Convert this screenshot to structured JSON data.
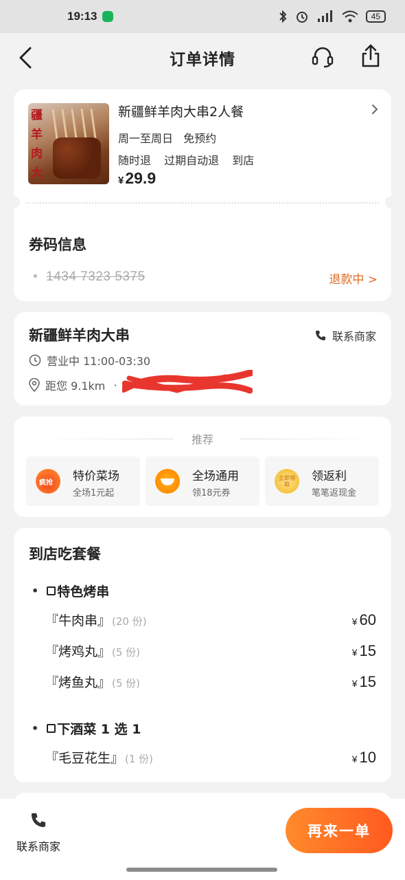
{
  "status_bar": {
    "time": "19:13",
    "battery": "45"
  },
  "nav": {
    "title": "订单详情"
  },
  "product": {
    "thumb_text": "疆羊肉大串",
    "name": "新疆鲜羊肉大串2人餐",
    "tags_line1": "周一至周日  免预约",
    "tags_line2": [
      "随时退",
      "过期自动退",
      "到店"
    ],
    "currency": "¥",
    "price": "29.9"
  },
  "voucher": {
    "title": "券码信息",
    "code": "1434 7323 5375",
    "status": "退款中 >"
  },
  "merchant": {
    "name": "新疆鲜羊肉大串",
    "contact_label": "联系商家",
    "hours": "营业中 11:00-03:30",
    "distance": "距您 9.1km",
    "separator": "·"
  },
  "recommend": {
    "header": "推荐",
    "items": [
      {
        "title": "特价菜场",
        "subtitle": "全场1元起",
        "icon": "hot-deal-icon"
      },
      {
        "title": "全场通用",
        "subtitle": "领18元券",
        "icon": "bowl-coupon-icon"
      },
      {
        "title": "领返利",
        "subtitle": "笔笔返现金",
        "icon": "cashback-coin-icon"
      }
    ]
  },
  "package": {
    "title": "到店吃套餐",
    "groups": [
      {
        "name": "特色烤串",
        "items": [
          {
            "name": "『牛肉串』",
            "qty": "(20 份)",
            "price": "60"
          },
          {
            "name": "『烤鸡丸』",
            "qty": "(5 份)",
            "price": "15"
          },
          {
            "name": "『烤鱼丸』",
            "qty": "(5 份)",
            "price": "15"
          }
        ]
      },
      {
        "name": "下酒菜 1 选 1",
        "items": [
          {
            "name": "『毛豆花生』",
            "qty": "(1 份)",
            "price": "10"
          }
        ]
      }
    ],
    "currency": "¥"
  },
  "bottom_bar": {
    "contact_label": "联系商家",
    "reorder_label": "再来一单"
  },
  "colors": {
    "accent": "#ff6a22",
    "status_orange": "#e06a22",
    "background": "#f2f2f2"
  }
}
